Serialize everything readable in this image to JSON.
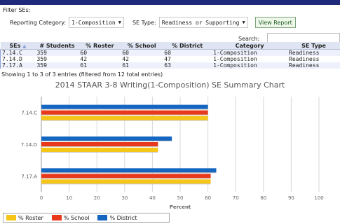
{
  "filter": {
    "title": "Filter SEs:",
    "reporting_label": "Reporting Category:",
    "reporting_value": "1-Composition",
    "setype_label": "SE Type:",
    "setype_value": "Readiness or Supporting",
    "button_label": "View Report"
  },
  "search": {
    "label": "Search:",
    "value": ""
  },
  "table": {
    "headers": [
      "SEs",
      "# Students",
      "% Roster",
      "% School",
      "% District",
      "Category",
      "SE Type"
    ],
    "sort_icon": "▲",
    "rows": [
      [
        "7.14.C",
        "359",
        "60",
        "60",
        "60",
        "1-Composition",
        "Readiness"
      ],
      [
        "7.14.D",
        "359",
        "42",
        "42",
        "47",
        "1-Composition",
        "Readiness"
      ],
      [
        "7.17.A",
        "359",
        "61",
        "61",
        "63",
        "1-Composition",
        "Readiness"
      ]
    ]
  },
  "info": "Showing 1 to 3 of 3 entries (filtered from 12 total entries)",
  "chart_data": {
    "type": "bar",
    "orientation": "horizontal",
    "title": "2014 STAAR 3-8 Writing(1-Composition) SE Summary Chart",
    "categories": [
      "7.14.C",
      "7.14.D",
      "7.17.A"
    ],
    "series": [
      {
        "name": "% Roster",
        "values": [
          60,
          42,
          61
        ],
        "color": "#f5c518"
      },
      {
        "name": "% School",
        "values": [
          60,
          42,
          61
        ],
        "color": "#e8391c"
      },
      {
        "name": "% District",
        "values": [
          60,
          47,
          63
        ],
        "color": "#1566c0"
      }
    ],
    "xlim": [
      0,
      100
    ],
    "xticks": [
      "0",
      "10",
      "20",
      "30",
      "40",
      "50",
      "60",
      "70",
      "80",
      "90",
      "100"
    ],
    "xlabel": "Percent",
    "grid": true,
    "legend_position": "bottom-left"
  }
}
